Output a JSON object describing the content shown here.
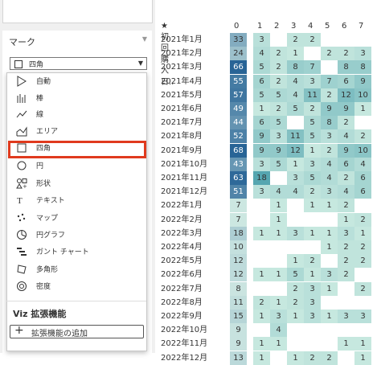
{
  "marks_panel": {
    "title": "マーク"
  },
  "mark_select": {
    "value": "四角"
  },
  "menu_items": [
    {
      "icon": "automatic-icon",
      "label": "自動"
    },
    {
      "icon": "bar-icon",
      "label": "棒"
    },
    {
      "icon": "line-icon",
      "label": "線"
    },
    {
      "icon": "area-icon",
      "label": "エリア"
    },
    {
      "icon": "square-icon",
      "label": "四角"
    },
    {
      "icon": "circle-icon",
      "label": "円"
    },
    {
      "icon": "shape-icon",
      "label": "形状"
    },
    {
      "icon": "text-icon",
      "label": "テキスト"
    },
    {
      "icon": "map-icon",
      "label": "マップ"
    },
    {
      "icon": "pie-icon",
      "label": "円グラフ"
    },
    {
      "icon": "gantt-icon",
      "label": "ガント チャート"
    },
    {
      "icon": "polygon-icon",
      "label": "多角形"
    },
    {
      "icon": "density-icon",
      "label": "密度"
    }
  ],
  "viz_extensions": {
    "title": "Viz 拡張機能",
    "add_label": "拡張機能の追加"
  },
  "table": {
    "row_header_label": "★初回購入日..",
    "columns": [
      "0",
      "1",
      "2",
      "3",
      "4",
      "5",
      "6",
      "7"
    ],
    "rows": [
      {
        "label": "2021年1月",
        "values": [
          "33",
          "3",
          "",
          "2",
          "2",
          "",
          "",
          ""
        ]
      },
      {
        "label": "2021年2月",
        "values": [
          "24",
          "4",
          "2",
          "1",
          "",
          "2",
          "2",
          "3"
        ]
      },
      {
        "label": "2021年3月",
        "values": [
          "66",
          "5",
          "2",
          "8",
          "7",
          "",
          "8",
          "8"
        ]
      },
      {
        "label": "2021年4月",
        "values": [
          "55",
          "6",
          "2",
          "4",
          "3",
          "7",
          "6",
          "9"
        ]
      },
      {
        "label": "2021年5月",
        "values": [
          "57",
          "5",
          "5",
          "4",
          "11",
          "2",
          "12",
          "10"
        ]
      },
      {
        "label": "2021年6月",
        "values": [
          "49",
          "1",
          "2",
          "5",
          "2",
          "9",
          "9",
          "1"
        ]
      },
      {
        "label": "2021年7月",
        "values": [
          "44",
          "6",
          "5",
          "",
          "5",
          "8",
          "2",
          ""
        ]
      },
      {
        "label": "2021年8月",
        "values": [
          "52",
          "9",
          "3",
          "11",
          "5",
          "3",
          "4",
          "2"
        ]
      },
      {
        "label": "2021年9月",
        "values": [
          "68",
          "9",
          "9",
          "12",
          "1",
          "2",
          "9",
          "10"
        ]
      },
      {
        "label": "2021年10月",
        "values": [
          "43",
          "3",
          "5",
          "1",
          "3",
          "4",
          "6",
          "4"
        ]
      },
      {
        "label": "2021年11月",
        "values": [
          "63",
          "18",
          "",
          "3",
          "5",
          "4",
          "2",
          "6"
        ]
      },
      {
        "label": "2021年12月",
        "values": [
          "51",
          "3",
          "4",
          "4",
          "2",
          "3",
          "4",
          "6"
        ]
      },
      {
        "label": "2022年1月",
        "values": [
          "7",
          "",
          "1",
          "",
          "1",
          "1",
          "2",
          ""
        ]
      },
      {
        "label": "2022年2月",
        "values": [
          "7",
          "",
          "1",
          "",
          "",
          "",
          "1",
          "2"
        ]
      },
      {
        "label": "2022年3月",
        "values": [
          "18",
          "1",
          "1",
          "3",
          "1",
          "1",
          "3",
          "1"
        ]
      },
      {
        "label": "2022年4月",
        "values": [
          "10",
          "",
          "",
          "",
          "",
          "1",
          "2",
          "2"
        ]
      },
      {
        "label": "2022年5月",
        "values": [
          "12",
          "",
          "",
          "1",
          "2",
          "",
          "2",
          "2"
        ]
      },
      {
        "label": "2022年6月",
        "values": [
          "12",
          "1",
          "1",
          "5",
          "1",
          "3",
          "2",
          ""
        ]
      },
      {
        "label": "2022年7月",
        "values": [
          "8",
          "",
          "",
          "2",
          "3",
          "1",
          "",
          "2"
        ]
      },
      {
        "label": "2022年8月",
        "values": [
          "11",
          "2",
          "1",
          "2",
          "3",
          "",
          "",
          ""
        ]
      },
      {
        "label": "2022年9月",
        "values": [
          "15",
          "1",
          "3",
          "1",
          "3",
          "1",
          "3",
          "3"
        ]
      },
      {
        "label": "2022年10月",
        "values": [
          "9",
          "",
          "4",
          "",
          "",
          "",
          "",
          ""
        ]
      },
      {
        "label": "2022年11月",
        "values": [
          "9",
          "1",
          "1",
          "",
          "",
          "",
          "1",
          "1"
        ]
      },
      {
        "label": "2022年12月",
        "values": [
          "13",
          "1",
          "",
          "1",
          "2",
          "2",
          "",
          "1"
        ]
      }
    ]
  },
  "colors": {
    "highlight": "#e03a1e",
    "heat_low": "#d2ede4",
    "heat_high": "#2f6f9e"
  }
}
